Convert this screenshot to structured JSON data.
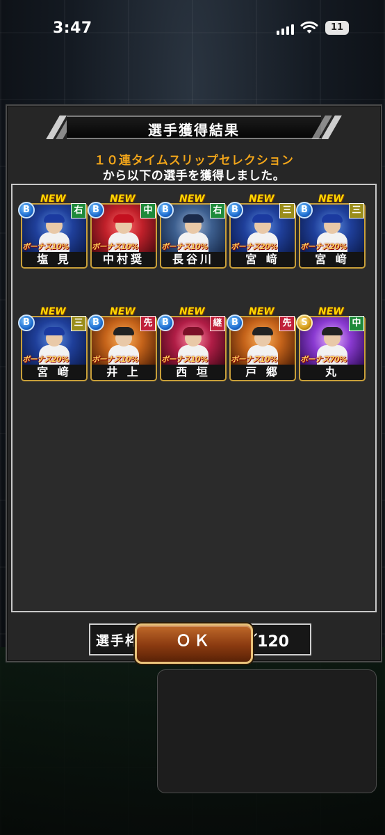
{
  "status_bar": {
    "time": "3:47",
    "battery": "11"
  },
  "dialog": {
    "title": "選手獲得結果",
    "subtitle": "１０連タイムスリップセレクション",
    "description": "から以下の選手を獲得しました。",
    "players": [
      {
        "name": "塩 見",
        "rank": "B",
        "position": "右",
        "bonus": "ボーナス10%",
        "new": "NEW",
        "color": "blue"
      },
      {
        "name": "中村奨",
        "rank": "B",
        "position": "中",
        "bonus": "ボーナス10%",
        "new": "NEW",
        "color": "red"
      },
      {
        "name": "長谷川",
        "rank": "B",
        "position": "右",
        "bonus": "ボーナス10%",
        "new": "NEW",
        "color": "bluegray"
      },
      {
        "name": "宮 﨑",
        "rank": "B",
        "position": "三",
        "bonus": "ボーナス20%",
        "new": "NEW",
        "color": "blue"
      },
      {
        "name": "宮 﨑",
        "rank": "B",
        "position": "三",
        "bonus": "ボーナス20%",
        "new": "NEW",
        "color": "blue"
      },
      {
        "name": "宮 﨑",
        "rank": "B",
        "position": "三",
        "bonus": "ボーナス20%",
        "new": "NEW",
        "color": "blue"
      },
      {
        "name": "井 上",
        "rank": "B",
        "position": "先",
        "bonus": "ボーナス10%",
        "new": "NEW",
        "color": "orange"
      },
      {
        "name": "西 垣",
        "rank": "B",
        "position": "継",
        "bonus": "ボーナス10%",
        "new": "NEW",
        "color": "crimson"
      },
      {
        "name": "戸 郷",
        "rank": "B",
        "position": "先",
        "bonus": "ボーナス10%",
        "new": "NEW",
        "color": "orange"
      },
      {
        "name": "丸",
        "rank": "S",
        "position": "中",
        "bonus": "ボーナス70%",
        "new": "NEW",
        "color": "purple"
      }
    ],
    "slots_label": "選手枠：",
    "slots_value": "87／120",
    "ok_label": "ＯＫ"
  }
}
